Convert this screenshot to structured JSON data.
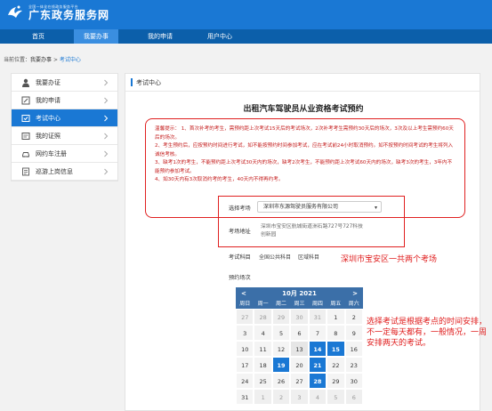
{
  "header": {
    "logo_sub": "全国一体化在线政务服务平台",
    "logo_main": "广东政务服务网"
  },
  "nav": {
    "items": [
      "首页",
      "我要办事",
      "我的申请",
      "用户中心"
    ]
  },
  "breadcrumb": {
    "prefix": "当前位置：",
    "link": "我要办事",
    "sep": " > ",
    "current": "考试中心"
  },
  "sidebar": {
    "items": [
      {
        "label": "我要办证",
        "icon": "user-icon"
      },
      {
        "label": "我的申请",
        "icon": "edit-icon"
      },
      {
        "label": "考试中心",
        "icon": "exam-icon"
      },
      {
        "label": "我的证照",
        "icon": "certificate-icon"
      },
      {
        "label": "网约车注册",
        "icon": "car-icon"
      },
      {
        "label": "巡游上岗信息",
        "icon": "document-icon"
      }
    ],
    "active_index": 2
  },
  "main": {
    "head": "考试中心",
    "title": "出租汽车驾驶员从业资格考试预约",
    "notice_lines": [
      "温馨提示： 1、首次补考的考生，需预约距上次考试15天后的考试场次，2次补考考生需预约30天后的场次，3次及以上考生需预约60天后的场次。",
      "2、考生预约后，应按预约时间进行考试，如不能按预约时间参加考试，应在考试前24小时取消预约。如不按预约时间考试的考生将列入诚信考核。",
      "3、缺考1次的考生，不能预约距上次考试30天内的场次，缺考2次考生，不能预约距上次考试60天内的场次，缺考3次的考生，3年内不能预约参加考试。",
      "4、如30天内有3次取消约考的考生，40天内不得再约考。"
    ],
    "venue_label": "选择考场",
    "venue_value": "深圳市东源驾驶员服务有限公司",
    "address_label": "考场地址",
    "address_value": "深圳市宝安区航城街道洲石路727号727科技创新园",
    "subjects_label": "考试科目",
    "subjects": [
      "全国公共科目",
      "区域科目"
    ],
    "slots_label": "预约场次"
  },
  "annotations": {
    "venue_note": "深圳市宝安区一共两个考场",
    "schedule_note": "选择考试是根据考点的时间安排，不一定每天都有，一般情况，一周安排两天的考试。"
  },
  "calendar": {
    "month_label": "10月 2021",
    "prev": "<",
    "next": ">",
    "weekdays": [
      "周日",
      "周一",
      "周二",
      "周三",
      "周四",
      "周五",
      "周六"
    ],
    "days": [
      {
        "d": "27",
        "s": "other"
      },
      {
        "d": "28",
        "s": "other"
      },
      {
        "d": "29",
        "s": "other"
      },
      {
        "d": "30",
        "s": "other"
      },
      {
        "d": "31",
        "s": "other"
      },
      {
        "d": "1",
        "s": ""
      },
      {
        "d": "2",
        "s": ""
      },
      {
        "d": "3",
        "s": ""
      },
      {
        "d": "4",
        "s": ""
      },
      {
        "d": "5",
        "s": ""
      },
      {
        "d": "6",
        "s": ""
      },
      {
        "d": "7",
        "s": ""
      },
      {
        "d": "8",
        "s": ""
      },
      {
        "d": "9",
        "s": ""
      },
      {
        "d": "10",
        "s": ""
      },
      {
        "d": "11",
        "s": ""
      },
      {
        "d": "12",
        "s": ""
      },
      {
        "d": "13",
        "s": "today"
      },
      {
        "d": "14",
        "s": "avail"
      },
      {
        "d": "15",
        "s": "avail"
      },
      {
        "d": "16",
        "s": ""
      },
      {
        "d": "17",
        "s": ""
      },
      {
        "d": "18",
        "s": ""
      },
      {
        "d": "19",
        "s": "avail"
      },
      {
        "d": "20",
        "s": ""
      },
      {
        "d": "21",
        "s": "avail"
      },
      {
        "d": "22",
        "s": ""
      },
      {
        "d": "23",
        "s": ""
      },
      {
        "d": "24",
        "s": ""
      },
      {
        "d": "25",
        "s": ""
      },
      {
        "d": "26",
        "s": ""
      },
      {
        "d": "27",
        "s": ""
      },
      {
        "d": "28",
        "s": "avail"
      },
      {
        "d": "29",
        "s": ""
      },
      {
        "d": "30",
        "s": ""
      },
      {
        "d": "31",
        "s": ""
      },
      {
        "d": "1",
        "s": "other"
      },
      {
        "d": "2",
        "s": "other"
      },
      {
        "d": "3",
        "s": "other"
      },
      {
        "d": "4",
        "s": "other"
      },
      {
        "d": "5",
        "s": "other"
      },
      {
        "d": "6",
        "s": "other"
      }
    ]
  },
  "colors": {
    "brand": "#1a78d4",
    "nav": "#0c5faa",
    "alert": "#e02020"
  }
}
